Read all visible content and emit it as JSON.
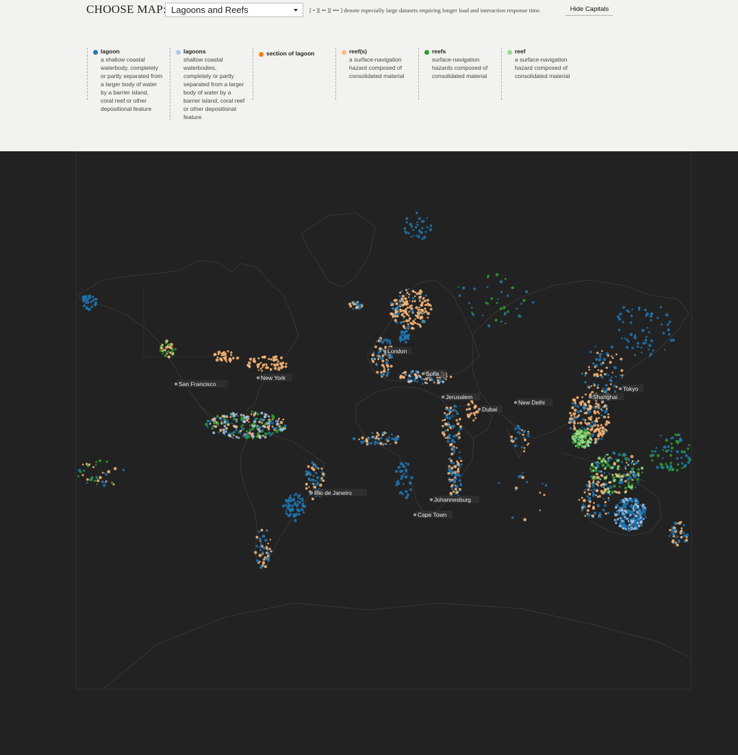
{
  "controls": {
    "choose_label": "CHOOSE MAP:",
    "selected_map": "Lagoons and Reefs",
    "note": "[ • ][ •• ][ ••• ] denote especially large datasets requiring longer load and interaction response time.",
    "hide_capitals": "Hide Capitals"
  },
  "legend": [
    {
      "title": "lagoon",
      "color": "#1f77b4",
      "desc": [
        "a shallow coastal",
        "waterbody, completely",
        "or partly separated from",
        "a larger body of water",
        "by a barrier island,",
        "coral reef or other",
        "depositional feature"
      ]
    },
    {
      "title": "lagoons",
      "color": "#aec7e8",
      "desc": [
        "shallow coastal",
        "waterbodies,",
        "completely or partly",
        "separated from a larger",
        "body of water by a",
        "barrier island, coral reef",
        "or other depositional",
        "feature"
      ]
    },
    {
      "title": "section of lagoon",
      "color": "#ff7f0e",
      "desc": []
    },
    {
      "title": "reef(s)",
      "color": "#ffbb78",
      "desc": [
        "a surface-navigation",
        "hazard composed of",
        "consolidated material"
      ]
    },
    {
      "title": "reefs",
      "color": "#2ca02c",
      "desc": [
        "surface-navigation",
        "hazards composed of",
        "consolidated material"
      ]
    },
    {
      "title": "reef",
      "color": "#98df8a",
      "desc": [
        "a surface-navigation",
        "hazard composed of",
        "consolidated material"
      ]
    }
  ],
  "map": {
    "background": "#222222",
    "land_stroke": "#3d3d3d",
    "capitals": [
      "London",
      "Sofia",
      "New York",
      "San Francisco",
      "Jerusalem",
      "Dubai",
      "New Delhi",
      "Shanghai",
      "Tokyo",
      "Rio de Janeiro",
      "Johannesburg",
      "Cape Town"
    ]
  }
}
